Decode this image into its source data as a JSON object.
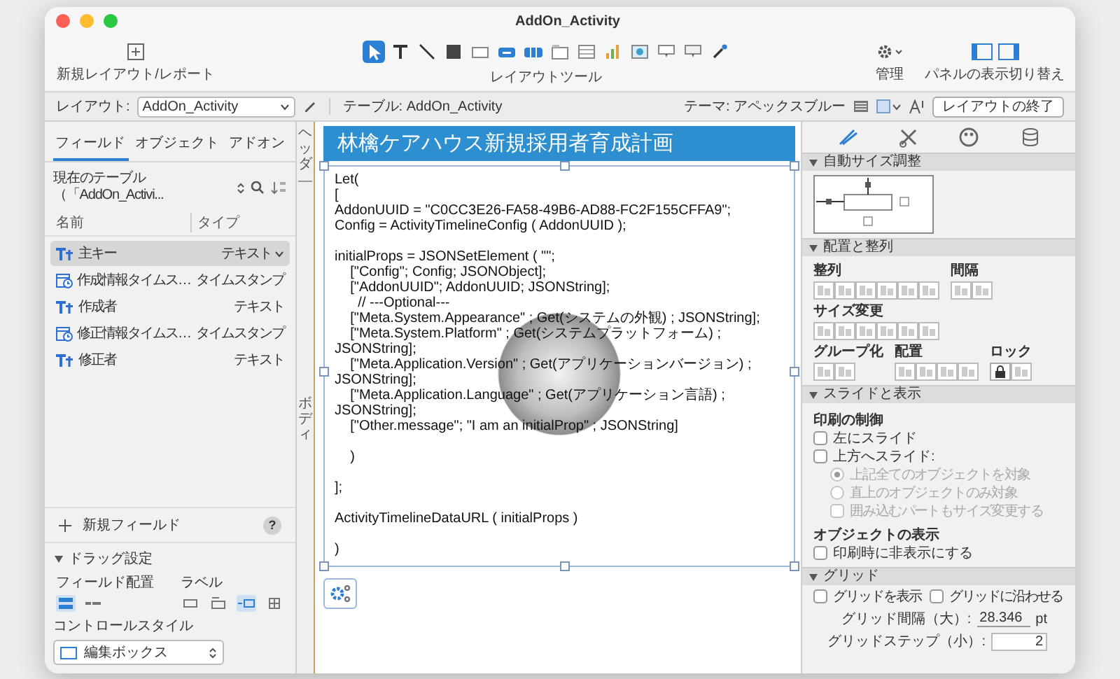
{
  "window": {
    "title": "AddOn_Activity"
  },
  "toolbar": {
    "new_layout_label": "新規レイアウト/レポート",
    "tools_label": "レイアウトツール",
    "manage_label": "管理",
    "panel_toggle_label": "パネルの表示切り替え",
    "tools": [
      {
        "kind": "pointer",
        "selected": true
      },
      {
        "kind": "text",
        "selected": false
      },
      {
        "kind": "line",
        "selected": false
      },
      {
        "kind": "shape",
        "selected": false
      },
      {
        "kind": "field",
        "selected": false
      },
      {
        "kind": "button",
        "selected": false
      },
      {
        "kind": "button-bar",
        "selected": false
      },
      {
        "kind": "tab-control",
        "selected": false
      },
      {
        "kind": "portal",
        "selected": false
      },
      {
        "kind": "chart",
        "selected": false
      },
      {
        "kind": "web-viewer",
        "selected": false
      },
      {
        "kind": "popover",
        "selected": false
      },
      {
        "kind": "popover-button",
        "selected": false
      },
      {
        "kind": "eyedropper",
        "selected": false
      }
    ]
  },
  "layout_bar": {
    "layout_label": "レイアウト:",
    "layout_value": "AddOn_Activity",
    "table_label": "テーブル: AddOn_Activity",
    "theme_label": "テーマ: アペックスブルー",
    "exit_button": "レイアウトの終了"
  },
  "left_panel": {
    "tabs": [
      {
        "label": "フィールド",
        "selected": true
      },
      {
        "label": "オブジェクト",
        "selected": false
      },
      {
        "label": "アドオン",
        "selected": false
      }
    ],
    "table_selector": "現在のテーブル（「AddOn_Activi...",
    "columns": [
      "名前",
      "タイプ"
    ],
    "fields": [
      {
        "name": "主キー",
        "type": "テキスト",
        "kind": "text",
        "selected": true
      },
      {
        "name": "作成情報タイムス…",
        "type": "タイムスタンプ",
        "kind": "timestamp",
        "selected": false
      },
      {
        "name": "作成者",
        "type": "テキスト",
        "kind": "text",
        "selected": false
      },
      {
        "name": "修正情報タイムス…",
        "type": "タイムスタンプ",
        "kind": "timestamp",
        "selected": false
      },
      {
        "name": "修正者",
        "type": "テキスト",
        "kind": "text",
        "selected": false
      }
    ],
    "new_field": "新規フィールド",
    "help": "?",
    "drag_settings": {
      "title": "ドラッグ設定",
      "expanded": true,
      "placement_label": "フィールド配置",
      "label_label": "ラベル",
      "placement_options": [
        {
          "kind": "vertical",
          "selected": true
        },
        {
          "kind": "horizontal",
          "selected": false
        }
      ],
      "label_options": [
        {
          "kind": "none",
          "selected": false
        },
        {
          "kind": "top",
          "selected": false
        },
        {
          "kind": "left",
          "selected": true
        },
        {
          "kind": "grid",
          "selected": false
        }
      ],
      "control_style_label": "コントロールスタイル",
      "control_style_value": "編集ボックス"
    }
  },
  "canvas": {
    "parts": [
      "ヘッダ",
      "ボディ"
    ],
    "header_title": "林檎ケアハウス新規採用者育成計画",
    "web_viewer_code": "Let(\n[\nAddonUUID = \"C0CC3E26-FA58-49B6-AD88-FC2F155CFFA9\";\nConfig = ActivityTimelineConfig ( AddonUUID );\n\ninitialProps = JSONSetElement ( \"\";\n    [\"Config\"; Config; JSONObject];\n    [\"AddonUUID\"; AddonUUID; JSONString];\n      // ---Optional---\n    [\"Meta.System.Appearance\" ; Get(システムの外観) ; JSONString];\n    [\"Meta.System.Platform\" ; Get(システムプラットフォーム) ; JSONString];\n    [\"Meta.Application.Version\" ; Get(アプリケーションバージョン) ; JSONString];\n    [\"Meta.Application.Language\" ; Get(アプリケーション言語) ; JSONString];\n    [\"Other.message\"; \"I am an initialProp\" ; JSONString]\n\n    )\n\n];\n\nActivityTimelineDataURL ( initialProps )\n\n)"
  },
  "inspector": {
    "tabs": [
      {
        "kind": "position",
        "selected": true
      },
      {
        "kind": "styles",
        "selected": false
      },
      {
        "kind": "appearance",
        "selected": false
      },
      {
        "kind": "data",
        "selected": false
      }
    ],
    "autosize": {
      "title": "自動サイズ調整",
      "expanded": true
    },
    "arrange": {
      "title": "配置と整列",
      "expanded": true,
      "rows": [
        [
          {
            "label": "整列",
            "kind": "align"
          },
          {
            "label": "間隔",
            "kind": "spacing"
          }
        ],
        [
          {
            "label": "サイズ変更",
            "kind": "resize"
          }
        ],
        [
          {
            "label": "グループ化",
            "kind": "group"
          },
          {
            "label": "配置",
            "kind": "arrange"
          },
          {
            "label": "ロック",
            "kind": "lock"
          }
        ]
      ]
    },
    "sliding": {
      "title": "スライドと表示",
      "expanded": true,
      "print_label": "印刷の制御",
      "options": [
        {
          "kind": "checkbox",
          "label": "左にスライド",
          "checked": false,
          "disabled": false
        },
        {
          "kind": "checkbox",
          "label": "上方へスライド:",
          "checked": false,
          "disabled": false,
          "children": [
            {
              "kind": "radio",
              "label": "上記全てのオブジェクトを対象",
              "selected": true,
              "disabled": true
            },
            {
              "kind": "radio",
              "label": "直上のオブジェクトのみ対象",
              "selected": false,
              "disabled": true
            },
            {
              "kind": "checkbox",
              "label": "囲み込むパートもサイズ変更する",
              "checked": false,
              "disabled": true
            }
          ]
        }
      ],
      "visibility_label": "オブジェクトの表示",
      "visibility_options": [
        {
          "kind": "checkbox",
          "label": "印刷時に非表示にする",
          "checked": false,
          "disabled": false
        }
      ]
    },
    "grid": {
      "title": "グリッド",
      "expanded": true,
      "options": [
        {
          "kind": "checkbox",
          "label": "グリッドを表示",
          "checked": false,
          "disabled": false
        },
        {
          "kind": "checkbox",
          "label": "グリッドに沿わせる",
          "checked": false,
          "disabled": false
        }
      ],
      "major_label": "グリッド間隔（大）:",
      "major_value": "28.346",
      "major_unit": "pt",
      "minor_label": "グリッドステップ（小）:",
      "minor_value": "2"
    }
  }
}
